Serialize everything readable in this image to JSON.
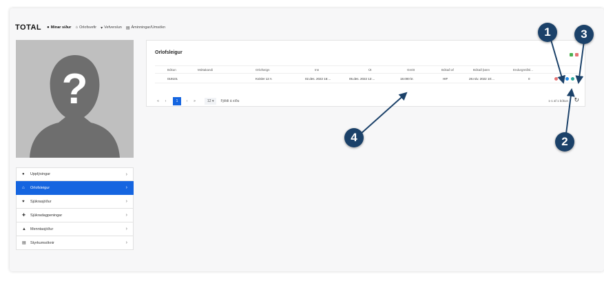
{
  "brand": {
    "logo": "TOTAL",
    "tagline": ""
  },
  "topnav": [
    {
      "label": "Mínar síður",
      "icon": "user-icon",
      "bold": true
    },
    {
      "label": "Orlofsvefir",
      "icon": "home-icon",
      "bold": false
    },
    {
      "label": "Vefverslun",
      "icon": "cart-icon",
      "bold": false
    },
    {
      "label": "Áminningar/Umsókn",
      "icon": "document-icon",
      "bold": false
    }
  ],
  "sidebar": {
    "items": [
      {
        "label": "Upplýsingar",
        "icon": "user-icon",
        "active": false
      },
      {
        "label": "Orlofsleigur",
        "icon": "home-icon",
        "active": true
      },
      {
        "label": "Sjúkrasjóður",
        "icon": "heart-icon",
        "active": false
      },
      {
        "label": "Sjúkradagpeningar",
        "icon": "health-icon",
        "active": false
      },
      {
        "label": "Menntasjóður",
        "icon": "graduation-icon",
        "active": false
      },
      {
        "label": "Styrkumsóknir",
        "icon": "form-icon",
        "active": false
      }
    ]
  },
  "panel": {
    "title": "Orlofsleigur",
    "colors": {
      "green": "#4caf50",
      "pink": "#e57373"
    }
  },
  "table": {
    "columns": [
      "Bókun",
      "Móttakandi",
      "Orlofseign",
      "Inn",
      "Út",
      "Greitt",
      "Bókað af",
      "Bókað þann",
      "Endurgreiðsl..."
    ],
    "rows": [
      {
        "cells": [
          "019101",
          "",
          "Kvisler 12 A",
          "02.des. 2022 16:...",
          "05.des. 2022 12:...",
          "18.000 kr.",
          "HIF",
          "28.nóv. 2022 10:...",
          "0"
        ]
      }
    ]
  },
  "row_actions": [
    {
      "name": "delete-icon",
      "color": "#e57373"
    },
    {
      "name": "receipt-icon",
      "color": "#9e9e9e"
    },
    {
      "name": "view-icon",
      "color": "#1e88e5"
    },
    {
      "name": "info-icon",
      "color": "#26a69a"
    }
  ],
  "pager": {
    "first": "«",
    "prev": "‹",
    "current": "1",
    "next": "›",
    "last": "»",
    "page_size": "12",
    "rows_label": "Fjöldi á síðu",
    "info": "1-1 af 1 bókun",
    "refresh_icon": "refresh-icon"
  },
  "callouts": [
    {
      "label": "1"
    },
    {
      "label": "2"
    },
    {
      "label": "3"
    },
    {
      "label": "4"
    }
  ],
  "callout_color": "#1b4169",
  "accent": "#1565e0"
}
